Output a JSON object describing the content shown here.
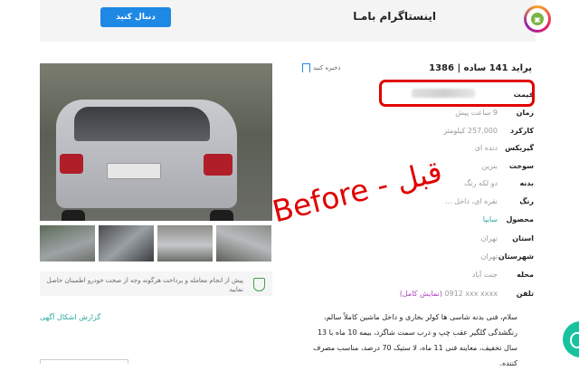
{
  "header": {
    "follow_button": "دنبال کنید",
    "brand_title": "اینستاگرام بامـا"
  },
  "ad": {
    "title": "پراید 141 ساده | 1386",
    "save_label": "ذخیره کنید",
    "details": [
      {
        "label": "قیمت",
        "value": "9,000,000 تومان",
        "blurred": true
      },
      {
        "label": "زمان",
        "value": "9 ساعت پیش"
      },
      {
        "label": "کارکرد",
        "value": "257,000 کیلومتر"
      },
      {
        "label": "گیربکس",
        "value": "دنده ای"
      },
      {
        "label": "سوخت",
        "value": "بنزین"
      },
      {
        "label": "بدنه",
        "value": "دو لکه رنگ"
      },
      {
        "label": "رنگ",
        "value": "نقره ای، داخل ..."
      },
      {
        "label": "محصول",
        "value": "سایپا",
        "accent": true
      },
      {
        "label": "استان",
        "value": "تهران"
      },
      {
        "label": "شهرستان",
        "value": "تهران"
      },
      {
        "label": "محله",
        "value": "جنت آباد"
      },
      {
        "label": "تلفن",
        "value": "0912 xxx xxxx",
        "link": "(نمایش کامل)"
      }
    ],
    "description": "سلام، فنی بدنه شاسی ها کولر بخاری و داخل ماشین کاملاً سالم، رنگشدگی گلگیر عقب چپ و درب سمت شاگرد، بیمه 10 ماه با 13 سال تخفیف، معاینه فنی 11 ماه، لا ستیک 70 درصد، مناسب مصرف کننده."
  },
  "notice": {
    "text": "پیش از انجام معامله و پرداخت هرگونه وجه از صحت خودرو اطمینان حاصل نمایید"
  },
  "report_link": "گزارش اشکال آگهی",
  "annotation": "Before - قبل",
  "colors": {
    "primary_button": "#1e88e5",
    "highlight_border": "#e00000",
    "accent_link": "#26a69a",
    "phone_link": "#ab47bc",
    "whatsapp": "#18c29f"
  }
}
